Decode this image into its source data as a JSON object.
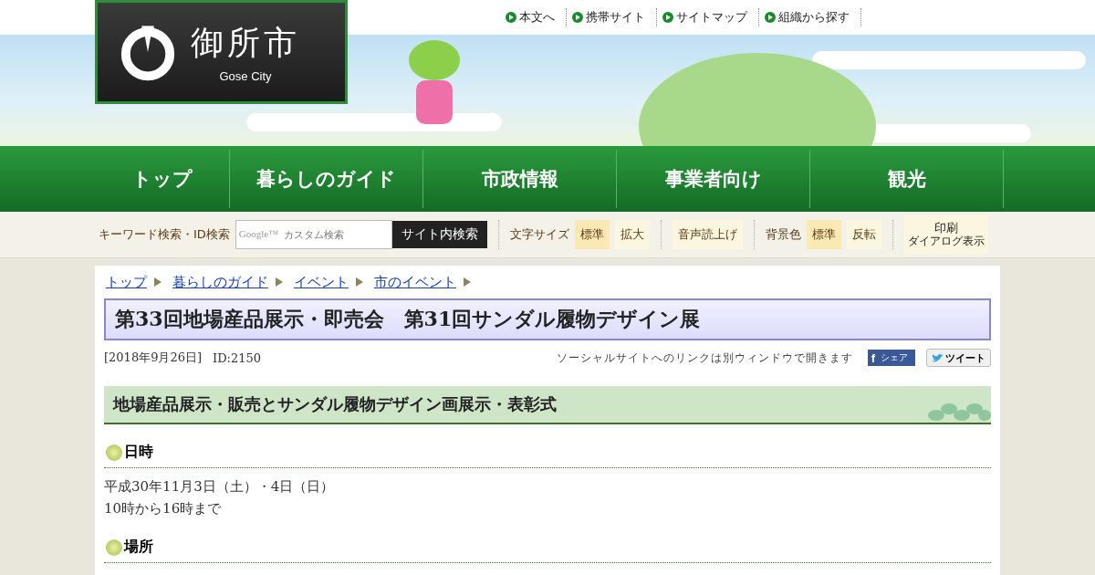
{
  "header": {
    "logo": {
      "name": "御所市",
      "subtitle": "Gose City"
    },
    "top_links": [
      "本文へ",
      "携帯サイト",
      "サイトマップ",
      "組織から探す"
    ]
  },
  "nav": [
    "トップ",
    "暮らしのガイド",
    "市政情報",
    "事業者向け",
    "観光"
  ],
  "toolbar": {
    "search_label": "キーワード検索・ID検索",
    "search": {
      "brand": "Google™",
      "placeholder": "カスタム検索"
    },
    "search_button": "サイト内検索",
    "text_size": {
      "label": "文字サイズ",
      "options": [
        {
          "label": "標準",
          "selected": true
        },
        {
          "label": "拡大",
          "selected": false
        }
      ]
    },
    "voice": "音声読上げ",
    "background": {
      "label": "背景色",
      "options": [
        {
          "label": "標準",
          "selected": true
        },
        {
          "label": "反転",
          "selected": false
        }
      ]
    },
    "print": {
      "label": "印刷",
      "sub": "ダイアログ表示"
    }
  },
  "breadcrumb": [
    "トップ",
    "暮らしのガイド",
    "イベント",
    "市のイベント"
  ],
  "title": "第33回地場産品展示・即売会　第31回サンダル履物デザイン展",
  "meta": {
    "date": "[2018年9月26日]",
    "id": "ID:2150",
    "social_note": "ソーシャルサイトへのリンクは別ウィンドウで開きます",
    "share_mark": "f",
    "share": "シェア",
    "tweet": "ツイート"
  },
  "section_heading": "地場産品展示・販売とサンダル履物デザイン画展示・表彰式",
  "subsections": [
    {
      "heading": "日時",
      "lines": [
        "平成30年11月3日（土）・4日（日）",
        "10時から16時まで"
      ]
    },
    {
      "heading": "場所"
    }
  ]
}
